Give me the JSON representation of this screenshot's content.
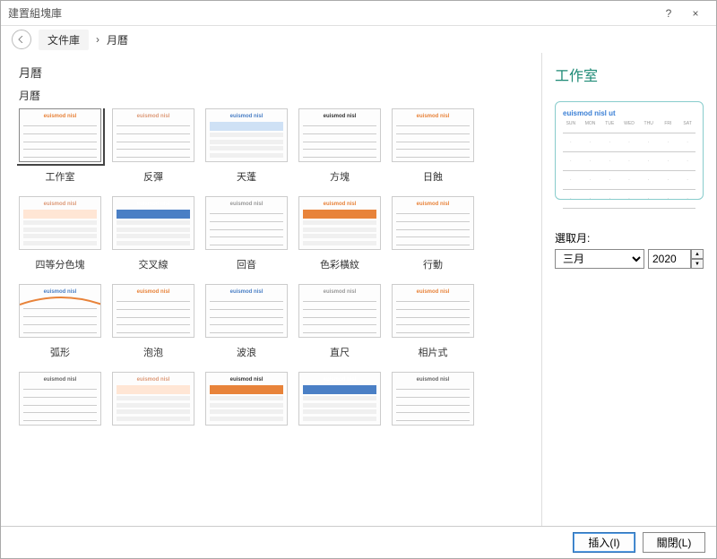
{
  "window": {
    "title": "建置組塊庫",
    "help": "?",
    "close": "×"
  },
  "breadcrumb": {
    "root": "文件庫",
    "sep": "›",
    "leaf": "月曆"
  },
  "category": {
    "title": "月曆",
    "subtitle": "月曆"
  },
  "tiles": [
    {
      "label": "工作室",
      "style": "studio"
    },
    {
      "label": "反彈",
      "style": "bounce"
    },
    {
      "label": "天蓬",
      "style": "canopy"
    },
    {
      "label": "方塊",
      "style": "blocks"
    },
    {
      "label": "日蝕",
      "style": "eclipse"
    },
    {
      "label": "四等分色塊",
      "style": "quad"
    },
    {
      "label": "交叉線",
      "style": "cross"
    },
    {
      "label": "回音",
      "style": "echo"
    },
    {
      "label": "色彩橫紋",
      "style": "stripes"
    },
    {
      "label": "行動",
      "style": "mobile"
    },
    {
      "label": "弧形",
      "style": "arc"
    },
    {
      "label": "泡泡",
      "style": "bubble"
    },
    {
      "label": "波浪",
      "style": "wave"
    },
    {
      "label": "直尺",
      "style": "ruler"
    },
    {
      "label": "相片式",
      "style": "photo"
    },
    {
      "label": "",
      "style": "p16"
    },
    {
      "label": "",
      "style": "p17"
    },
    {
      "label": "",
      "style": "p18"
    },
    {
      "label": "",
      "style": "p19"
    },
    {
      "label": "",
      "style": "p20"
    }
  ],
  "preview": {
    "title": "工作室",
    "headerText": "euismod nisl ut",
    "days": [
      "SUN",
      "MON",
      "TUE",
      "WED",
      "THU",
      "FRI",
      "SAT"
    ],
    "monthLabel": "選取月:",
    "monthValue": "三月",
    "yearValue": "2020"
  },
  "footer": {
    "insert": "插入(I)",
    "close": "關閉(L)"
  }
}
